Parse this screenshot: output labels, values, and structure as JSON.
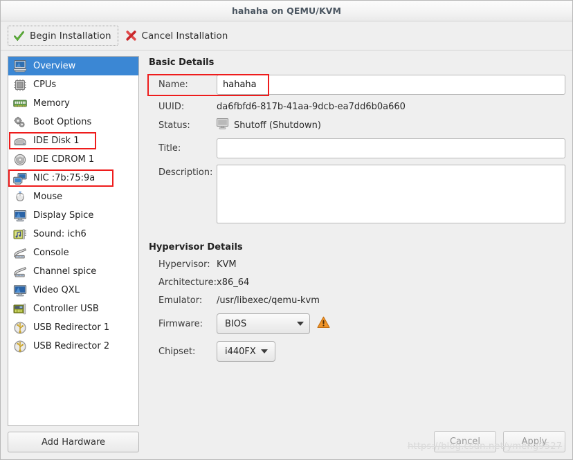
{
  "window": {
    "title": "hahaha on QEMU/KVM"
  },
  "toolbar": {
    "begin_label": "Begin Installation",
    "begin_icon": "green-check-icon",
    "cancel_label": "Cancel Installation",
    "cancel_icon": "red-x-icon"
  },
  "sidebar": {
    "add_hardware_label": "Add Hardware",
    "items": [
      {
        "label": "Overview",
        "icon": "computer-monitor-icon",
        "selected": true
      },
      {
        "label": "CPUs",
        "icon": "cpu-chip-icon",
        "selected": false
      },
      {
        "label": "Memory",
        "icon": "memory-ram-icon",
        "selected": false
      },
      {
        "label": "Boot Options",
        "icon": "gears-icon",
        "selected": false
      },
      {
        "label": "IDE Disk 1",
        "icon": "hard-disk-icon",
        "selected": false,
        "highlight": true
      },
      {
        "label": "IDE CDROM 1",
        "icon": "optical-disc-icon",
        "selected": false
      },
      {
        "label": "NIC :7b:75:9a",
        "icon": "network-card-icon",
        "selected": false,
        "highlight": true
      },
      {
        "label": "Mouse",
        "icon": "mouse-icon",
        "selected": false
      },
      {
        "label": "Display Spice",
        "icon": "display-icon",
        "selected": false
      },
      {
        "label": "Sound: ich6",
        "icon": "sound-card-icon",
        "selected": false
      },
      {
        "label": "Console",
        "icon": "console-icon",
        "selected": false
      },
      {
        "label": "Channel spice",
        "icon": "console-icon",
        "selected": false
      },
      {
        "label": "Video QXL",
        "icon": "video-card-icon",
        "selected": false
      },
      {
        "label": "Controller USB",
        "icon": "controller-card-icon",
        "selected": false
      },
      {
        "label": "USB Redirector 1",
        "icon": "usb-icon",
        "selected": false
      },
      {
        "label": "USB Redirector 2",
        "icon": "usb-icon",
        "selected": false
      }
    ]
  },
  "basic_details": {
    "heading": "Basic Details",
    "name_label": "Name:",
    "name_value": "hahaha",
    "uuid_label": "UUID:",
    "uuid_value": "da6fbfd6-817b-41aa-9dcb-ea7dd6b0a660",
    "status_label": "Status:",
    "status_value": "Shutoff (Shutdown)",
    "status_icon": "shutoff-monitor-icon",
    "title_label": "Title:",
    "title_value": "",
    "description_label": "Description:",
    "description_value": ""
  },
  "hypervisor_details": {
    "heading": "Hypervisor Details",
    "hypervisor_label": "Hypervisor:",
    "hypervisor_value": "KVM",
    "architecture_label": "Architecture:",
    "architecture_value": "x86_64",
    "emulator_label": "Emulator:",
    "emulator_value": "/usr/libexec/qemu-kvm",
    "firmware_label": "Firmware:",
    "firmware_value": "BIOS",
    "firmware_warning_icon": "warning-triangle-icon",
    "chipset_label": "Chipset:",
    "chipset_value": "i440FX"
  },
  "footer": {
    "cancel_label": "Cancel",
    "apply_label": "Apply"
  },
  "watermark": {
    "text": "https://blog.csdn.net/ymeng9527"
  },
  "colors": {
    "selection": "#3b87d4",
    "highlight_box": "#ee1c1c",
    "warning": "#f0952a",
    "ok": "#5fb83d"
  }
}
